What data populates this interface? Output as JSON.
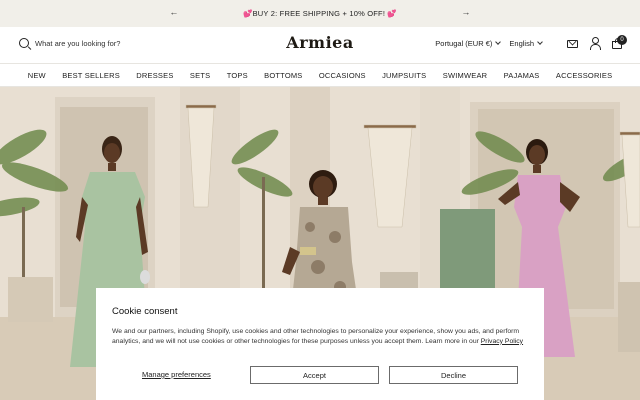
{
  "announcement": {
    "prev_icon": "arrow-left-icon",
    "next_icon": "arrow-right-icon",
    "message": "💕BUY 2: FREE SHIPPING + 10% OFF! 💕"
  },
  "header": {
    "logo": "Armiea",
    "search_placeholder": "What are you looking for?",
    "country": "Portugal (EUR €)",
    "language": "English",
    "cart_count": "0",
    "icons": [
      "search-icon",
      "mail-icon",
      "account-icon",
      "cart-icon"
    ]
  },
  "nav": {
    "items": [
      "NEW",
      "BEST SELLERS",
      "DRESSES",
      "SETS",
      "TOPS",
      "BOTTOMS",
      "OCCASIONS",
      "JUMPSUITS",
      "SWIMWEAR",
      "PAJAMAS",
      "ACCESSORIES"
    ]
  },
  "cookie": {
    "title": "Cookie consent",
    "body": "We and our partners, including Shopify, use cookies and other technologies to personalize your experience, show you ads, and perform analytics, and we will not use cookies or other technologies for these purposes unless you accept them. Learn more in our ",
    "policy_link": "Privacy Policy",
    "manage_label": "Manage preferences",
    "accept_label": "Accept",
    "decline_label": "Decline"
  },
  "colors": {
    "announcement_bg": "#f1efe9",
    "hero_wall": "#e9e1d5",
    "dress_green": "#a9c3a1",
    "dress_pink": "#d9a1c4"
  }
}
